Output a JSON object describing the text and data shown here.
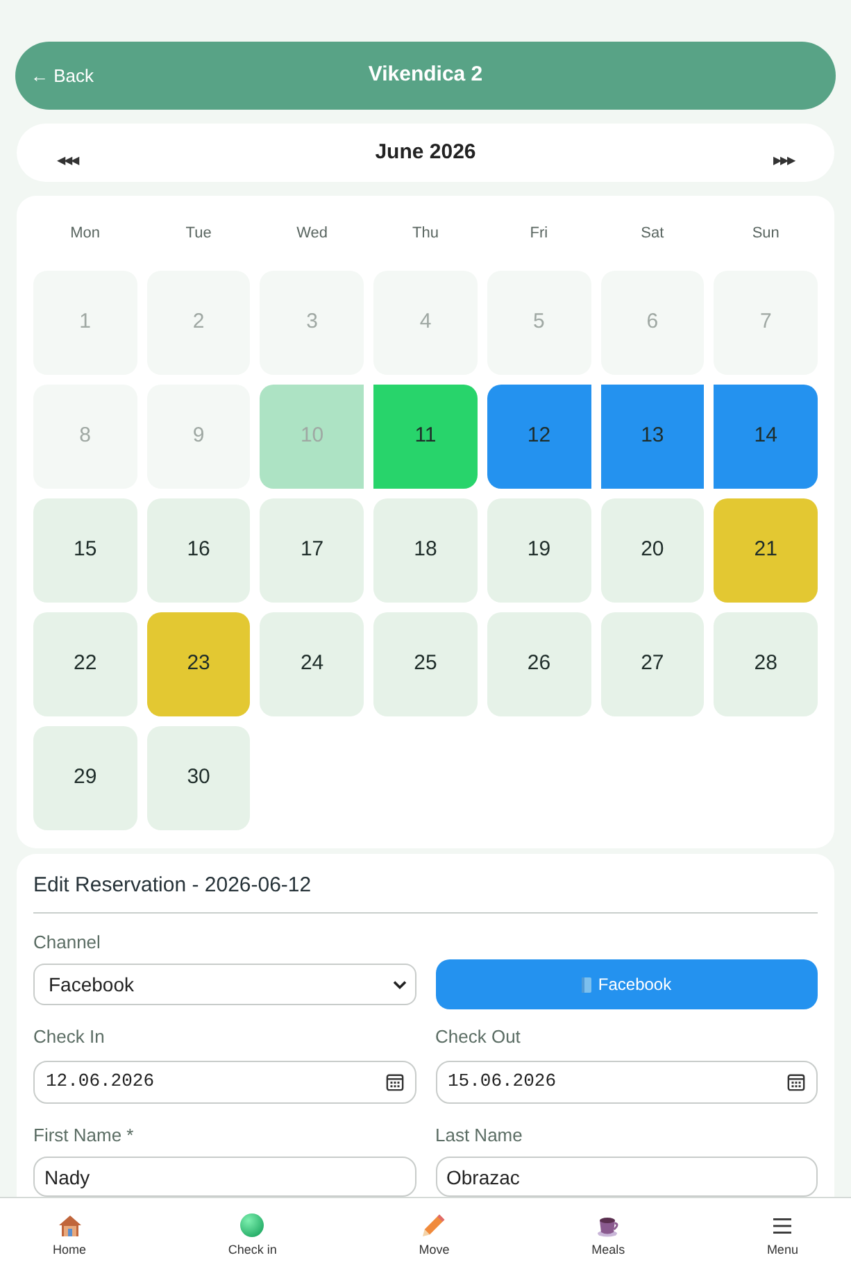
{
  "header": {
    "back": "← Back",
    "title": "Vikendica 2"
  },
  "month_nav": {
    "prev": "◀◀◀",
    "title": "June 2026",
    "next": "▶▶▶"
  },
  "calendar": {
    "weekdays": [
      "Mon",
      "Tue",
      "Wed",
      "Thu",
      "Fri",
      "Sat",
      "Sun"
    ],
    "days": [
      {
        "day": "1",
        "past": true,
        "joins_left": false,
        "joins_right": false
      },
      {
        "day": "2",
        "past": true,
        "joins_left": false,
        "joins_right": false
      },
      {
        "day": "3",
        "past": true,
        "joins_left": false,
        "joins_right": false
      },
      {
        "day": "4",
        "past": true,
        "joins_left": false,
        "joins_right": false
      },
      {
        "day": "5",
        "past": true,
        "joins_left": false,
        "joins_right": false
      },
      {
        "day": "6",
        "past": true,
        "joins_left": false,
        "joins_right": false
      },
      {
        "day": "7",
        "past": true,
        "joins_left": false,
        "joins_right": false
      },
      {
        "day": "8",
        "past": true,
        "joins_left": false,
        "joins_right": false
      },
      {
        "day": "9",
        "past": true,
        "joins_left": false,
        "joins_right": false
      },
      {
        "day": "10",
        "past": true,
        "color": "#ade3c4",
        "joins_left": false,
        "joins_right": true
      },
      {
        "day": "11",
        "past": false,
        "color": "#28d46b",
        "joins_left": true,
        "joins_right": false
      },
      {
        "day": "12",
        "past": false,
        "color": "#2492ef",
        "joins_left": false,
        "joins_right": true
      },
      {
        "day": "13",
        "past": false,
        "color": "#2492ef",
        "joins_left": true,
        "joins_right": true
      },
      {
        "day": "14",
        "past": false,
        "color": "#2492ef",
        "joins_left": true,
        "joins_right": false
      },
      {
        "day": "15",
        "past": false,
        "joins_left": false,
        "joins_right": false
      },
      {
        "day": "16",
        "past": false,
        "joins_left": false,
        "joins_right": false
      },
      {
        "day": "17",
        "past": false,
        "joins_left": false,
        "joins_right": false
      },
      {
        "day": "18",
        "past": false,
        "joins_left": false,
        "joins_right": false
      },
      {
        "day": "19",
        "past": false,
        "joins_left": false,
        "joins_right": false
      },
      {
        "day": "20",
        "past": false,
        "joins_left": false,
        "joins_right": false
      },
      {
        "day": "21",
        "past": false,
        "color": "#e3c832",
        "joins_left": false,
        "joins_right": false
      },
      {
        "day": "22",
        "past": false,
        "joins_left": false,
        "joins_right": false
      },
      {
        "day": "23",
        "past": false,
        "color": "#e3c832",
        "joins_left": false,
        "joins_right": false
      },
      {
        "day": "24",
        "past": false,
        "joins_left": false,
        "joins_right": false
      },
      {
        "day": "25",
        "past": false,
        "joins_left": false,
        "joins_right": false
      },
      {
        "day": "26",
        "past": false,
        "joins_left": false,
        "joins_right": false
      },
      {
        "day": "27",
        "past": false,
        "joins_left": false,
        "joins_right": false
      },
      {
        "day": "28",
        "past": false,
        "joins_left": false,
        "joins_right": false
      },
      {
        "day": "29",
        "past": false,
        "joins_left": false,
        "joins_right": false
      },
      {
        "day": "30",
        "past": false,
        "joins_left": false,
        "joins_right": false
      }
    ]
  },
  "edit_form": {
    "title": "Edit Reservation - 2026-06-12",
    "channel": {
      "label": "Channel",
      "value": "Facebook"
    },
    "channel_button": {
      "label": "Facebook"
    },
    "check_in": {
      "label": "Check In",
      "value": "12.06.2026"
    },
    "check_out": {
      "label": "Check Out",
      "value": "15.06.2026"
    },
    "first_name": {
      "label": "First Name *",
      "value": "Nady"
    },
    "last_name": {
      "label": "Last Name",
      "value": "Obrazac"
    }
  },
  "bottom_nav": [
    {
      "label": "Home",
      "kind": "home"
    },
    {
      "label": "Check in",
      "kind": "check-in"
    },
    {
      "label": "Move",
      "kind": "move"
    },
    {
      "label": "Meals",
      "kind": "meals"
    },
    {
      "label": "Menu",
      "kind": "menu"
    }
  ]
}
